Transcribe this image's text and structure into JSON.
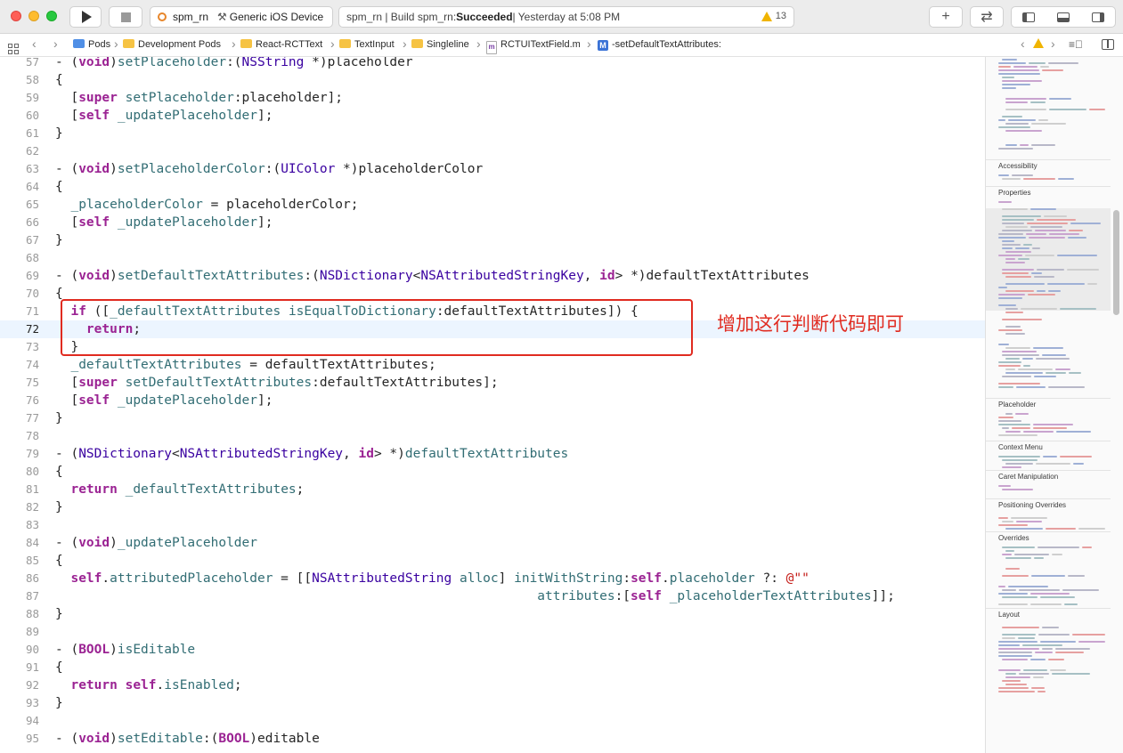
{
  "toolbar": {
    "scheme": "spm_rn",
    "device": "Generic iOS Device",
    "activity_prefix": "spm_rn | Build spm_rn: ",
    "activity_status": "Succeeded",
    "activity_time": " | Yesterday at 5:08 PM",
    "warning_count": "13"
  },
  "breadcrumb": {
    "items": [
      "Pods",
      "Development Pods",
      "React-RCTText",
      "TextInput",
      "Singleline",
      "RCTUITextField.m",
      "-setDefaultTextAttributes:"
    ],
    "file_badge": "m",
    "method_badge": "M"
  },
  "editor": {
    "lines": [
      {
        "n": "57",
        "segs": [
          [
            "p",
            "- ("
          ],
          [
            "k",
            "void"
          ],
          [
            "p",
            ")"
          ],
          [
            "m",
            "setPlaceholder"
          ],
          [
            "p",
            ":("
          ],
          [
            "t",
            "NSString"
          ],
          [
            "p",
            " *)placeholder"
          ]
        ]
      },
      {
        "n": "58",
        "segs": [
          [
            "p",
            "{"
          ]
        ]
      },
      {
        "n": "59",
        "segs": [
          [
            "p",
            "  ["
          ],
          [
            "k",
            "super"
          ],
          [
            "p",
            " "
          ],
          [
            "m",
            "setPlaceholder"
          ],
          [
            "p",
            ":placeholder];"
          ]
        ]
      },
      {
        "n": "60",
        "segs": [
          [
            "p",
            "  ["
          ],
          [
            "k",
            "self"
          ],
          [
            "p",
            " "
          ],
          [
            "m",
            "_updatePlaceholder"
          ],
          [
            "p",
            "];"
          ]
        ]
      },
      {
        "n": "61",
        "segs": [
          [
            "p",
            "}"
          ]
        ]
      },
      {
        "n": "62",
        "segs": []
      },
      {
        "n": "63",
        "segs": [
          [
            "p",
            "- ("
          ],
          [
            "k",
            "void"
          ],
          [
            "p",
            ")"
          ],
          [
            "m",
            "setPlaceholderColor"
          ],
          [
            "p",
            ":("
          ],
          [
            "t",
            "UIColor"
          ],
          [
            "p",
            " *)placeholderColor"
          ]
        ]
      },
      {
        "n": "64",
        "segs": [
          [
            "p",
            "{"
          ]
        ]
      },
      {
        "n": "65",
        "segs": [
          [
            "p",
            "  "
          ],
          [
            "m",
            "_placeholderColor"
          ],
          [
            "p",
            " = placeholderColor;"
          ]
        ]
      },
      {
        "n": "66",
        "segs": [
          [
            "p",
            "  ["
          ],
          [
            "k",
            "self"
          ],
          [
            "p",
            " "
          ],
          [
            "m",
            "_updatePlaceholder"
          ],
          [
            "p",
            "];"
          ]
        ]
      },
      {
        "n": "67",
        "segs": [
          [
            "p",
            "}"
          ]
        ]
      },
      {
        "n": "68",
        "segs": []
      },
      {
        "n": "69",
        "segs": [
          [
            "p",
            "- ("
          ],
          [
            "k",
            "void"
          ],
          [
            "p",
            ")"
          ],
          [
            "m",
            "setDefaultTextAttributes"
          ],
          [
            "p",
            ":("
          ],
          [
            "t",
            "NSDictionary"
          ],
          [
            "p",
            "<"
          ],
          [
            "t",
            "NSAttributedStringKey"
          ],
          [
            "p",
            ", "
          ],
          [
            "k",
            "id"
          ],
          [
            "p",
            "> *)defaultTextAttributes"
          ]
        ]
      },
      {
        "n": "70",
        "segs": [
          [
            "p",
            "{"
          ]
        ]
      },
      {
        "n": "71",
        "segs": [
          [
            "p",
            "  "
          ],
          [
            "k",
            "if"
          ],
          [
            "p",
            " (["
          ],
          [
            "m",
            "_defaultTextAttributes"
          ],
          [
            "p",
            " "
          ],
          [
            "m",
            "isEqualToDictionary"
          ],
          [
            "p",
            ":defaultTextAttributes]) {"
          ]
        ]
      },
      {
        "n": "72",
        "segs": [
          [
            "p",
            "    "
          ],
          [
            "k",
            "return"
          ],
          [
            "p",
            ";"
          ]
        ]
      },
      {
        "n": "73",
        "segs": [
          [
            "p",
            "  }"
          ]
        ]
      },
      {
        "n": "74",
        "segs": [
          [
            "p",
            "  "
          ],
          [
            "m",
            "_defaultTextAttributes"
          ],
          [
            "p",
            " = defaultTextAttributes;"
          ]
        ]
      },
      {
        "n": "75",
        "segs": [
          [
            "p",
            "  ["
          ],
          [
            "k",
            "super"
          ],
          [
            "p",
            " "
          ],
          [
            "m",
            "setDefaultTextAttributes"
          ],
          [
            "p",
            ":defaultTextAttributes];"
          ]
        ]
      },
      {
        "n": "76",
        "segs": [
          [
            "p",
            "  ["
          ],
          [
            "k",
            "self"
          ],
          [
            "p",
            " "
          ],
          [
            "m",
            "_updatePlaceholder"
          ],
          [
            "p",
            "];"
          ]
        ]
      },
      {
        "n": "77",
        "segs": [
          [
            "p",
            "}"
          ]
        ]
      },
      {
        "n": "78",
        "segs": []
      },
      {
        "n": "79",
        "segs": [
          [
            "p",
            "- ("
          ],
          [
            "t",
            "NSDictionary"
          ],
          [
            "p",
            "<"
          ],
          [
            "t",
            "NSAttributedStringKey"
          ],
          [
            "p",
            ", "
          ],
          [
            "k",
            "id"
          ],
          [
            "p",
            "> *)"
          ],
          [
            "m",
            "defaultTextAttributes"
          ]
        ]
      },
      {
        "n": "80",
        "segs": [
          [
            "p",
            "{"
          ]
        ]
      },
      {
        "n": "81",
        "segs": [
          [
            "p",
            "  "
          ],
          [
            "k",
            "return"
          ],
          [
            "p",
            " "
          ],
          [
            "m",
            "_defaultTextAttributes"
          ],
          [
            "p",
            ";"
          ]
        ]
      },
      {
        "n": "82",
        "segs": [
          [
            "p",
            "}"
          ]
        ]
      },
      {
        "n": "83",
        "segs": []
      },
      {
        "n": "84",
        "segs": [
          [
            "p",
            "- ("
          ],
          [
            "k",
            "void"
          ],
          [
            "p",
            ")"
          ],
          [
            "m",
            "_updatePlaceholder"
          ]
        ]
      },
      {
        "n": "85",
        "segs": [
          [
            "p",
            "{"
          ]
        ]
      },
      {
        "n": "86",
        "segs": [
          [
            "p",
            "  "
          ],
          [
            "k",
            "self"
          ],
          [
            "p",
            "."
          ],
          [
            "m",
            "attributedPlaceholder"
          ],
          [
            "p",
            " = [["
          ],
          [
            "t",
            "NSAttributedString"
          ],
          [
            "p",
            " "
          ],
          [
            "m",
            "alloc"
          ],
          [
            "p",
            "] "
          ],
          [
            "m",
            "initWithString"
          ],
          [
            "p",
            ":"
          ],
          [
            "k",
            "self"
          ],
          [
            "p",
            "."
          ],
          [
            "m",
            "placeholder"
          ],
          [
            "p",
            " ?: "
          ],
          [
            "s",
            "@\"\""
          ]
        ]
      },
      {
        "n": "87",
        "segs": [
          [
            "p",
            "                                                              "
          ],
          [
            "m",
            "attributes"
          ],
          [
            "p",
            ":["
          ],
          [
            "k",
            "self"
          ],
          [
            "p",
            " "
          ],
          [
            "m",
            "_placeholderTextAttributes"
          ],
          [
            "p",
            "]];"
          ]
        ]
      },
      {
        "n": "88",
        "segs": [
          [
            "p",
            "}"
          ]
        ]
      },
      {
        "n": "89",
        "segs": []
      },
      {
        "n": "90",
        "segs": [
          [
            "p",
            "- ("
          ],
          [
            "k",
            "BOOL"
          ],
          [
            "p",
            ")"
          ],
          [
            "m",
            "isEditable"
          ]
        ]
      },
      {
        "n": "91",
        "segs": [
          [
            "p",
            "{"
          ]
        ]
      },
      {
        "n": "92",
        "segs": [
          [
            "p",
            "  "
          ],
          [
            "k",
            "return"
          ],
          [
            "p",
            " "
          ],
          [
            "k",
            "self"
          ],
          [
            "p",
            "."
          ],
          [
            "m",
            "isEnabled"
          ],
          [
            "p",
            ";"
          ]
        ]
      },
      {
        "n": "93",
        "segs": [
          [
            "p",
            "}"
          ]
        ]
      },
      {
        "n": "94",
        "segs": []
      },
      {
        "n": "95",
        "segs": [
          [
            "p",
            "- ("
          ],
          [
            "k",
            "void"
          ],
          [
            "p",
            ")"
          ],
          [
            "m",
            "setEditable"
          ],
          [
            "p",
            ":("
          ],
          [
            "k",
            "BOOL"
          ],
          [
            "p",
            ")editable"
          ]
        ]
      }
    ],
    "highlighted_line": "72",
    "annotation": "增加这行判断代码即可"
  },
  "minimap": {
    "sections": [
      "Accessibility",
      "Properties",
      "Placeholder",
      "Context Menu",
      "Caret Manipulation",
      "Positioning Overrides",
      "Overrides",
      "Layout"
    ]
  },
  "colors": {
    "keyword": "#9b2393",
    "method": "#326d74",
    "type": "#3900a0",
    "string": "#c41a16",
    "annotation": "#e02b20",
    "current_line": "#ecf5ff"
  }
}
